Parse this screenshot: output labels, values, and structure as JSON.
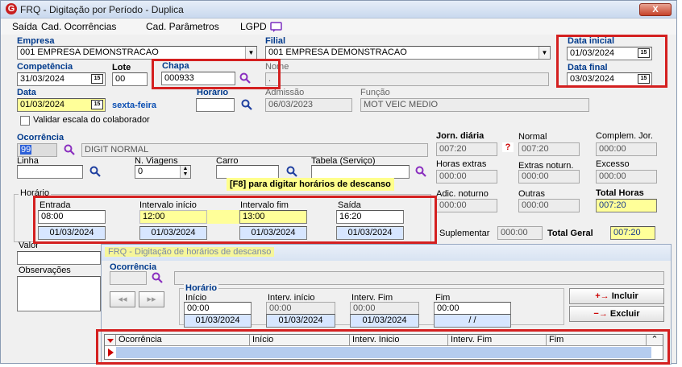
{
  "window": {
    "title": "FRQ - Digitação por Período - Duplica",
    "close_label": "X"
  },
  "menu": [
    {
      "label": "Saída"
    },
    {
      "label": "Cad. Ocorrências"
    },
    {
      "label": "Cad. Parâmetros"
    },
    {
      "label": "LGPD"
    }
  ],
  "empresa": {
    "label": "Empresa",
    "value": "001 EMPRESA DEMONSTRACAO"
  },
  "filial": {
    "label": "Filial",
    "value": "001 EMPRESA DEMONSTRACAO"
  },
  "data_inicial": {
    "label": "Data inicial",
    "value": "01/03/2024"
  },
  "data_final": {
    "label": "Data final",
    "value": "03/03/2024"
  },
  "competencia": {
    "label": "Competência",
    "value": "31/03/2024"
  },
  "lote": {
    "label": "Lote",
    "value": "00"
  },
  "chapa": {
    "label": "Chapa",
    "value": "000933"
  },
  "nome": {
    "label": "Nome",
    "value": "."
  },
  "data": {
    "label": "Data",
    "value": "01/03/2024",
    "weekday": "sexta-feira"
  },
  "horario": {
    "label": "Horário",
    "value": ""
  },
  "admissao": {
    "label": "Admissão",
    "value": "06/03/2023"
  },
  "funcao": {
    "label": "Função",
    "value": "MOT VEIC MEDIO"
  },
  "validar": {
    "label": "Validar escala do colaborador"
  },
  "ocorrencia": {
    "label": "Ocorrência",
    "code": "99",
    "desc": "DIGIT NORMAL"
  },
  "linha": {
    "label": "Linha",
    "value": ""
  },
  "viagens": {
    "label": "N. Viagens",
    "value": "0"
  },
  "carro": {
    "label": "Carro",
    "value": ""
  },
  "tabela": {
    "label": "Tabela (Serviço)",
    "value": ""
  },
  "hint_f8": "[F8] para digitar horários de descanso",
  "jornada": {
    "jorn_diaria": {
      "label": "Jorn. diária",
      "value": "007:20"
    },
    "normal": {
      "label": "Normal",
      "value": "007:20"
    },
    "complem": {
      "label": "Complem. Jor.",
      "value": "000:00"
    },
    "horas_extras": {
      "label": "Horas extras",
      "value": "000:00"
    },
    "extras_notu": {
      "label": "Extras noturn.",
      "value": "000:00"
    },
    "excesso": {
      "label": "Excesso",
      "value": "000:00"
    },
    "adic_noturno": {
      "label": "Adic. noturno",
      "value": "000:00"
    },
    "outras": {
      "label": "Outras",
      "value": "000:00"
    },
    "total_horas": {
      "label": "Total Horas",
      "value": "007:20"
    },
    "suplementar": {
      "label": "Suplementar",
      "value": "000:00"
    },
    "total_geral": {
      "label": "Total Geral",
      "value": "007:20"
    },
    "question": "?"
  },
  "horario_group": {
    "label": "Horário",
    "entrada": {
      "label": "Entrada",
      "time": "08:00",
      "date": "01/03/2024"
    },
    "int_inicio": {
      "label": "Intervalo início",
      "time": "12:00",
      "date": "01/03/2024"
    },
    "int_fim": {
      "label": "Intervalo fim",
      "time": "13:00",
      "date": "01/03/2024"
    },
    "saida": {
      "label": "Saída",
      "time": "16:20",
      "date": "01/03/2024"
    }
  },
  "valor": {
    "label": "Valor"
  },
  "observacoes": {
    "label": "Observações"
  },
  "sub": {
    "title": "FRQ - Digitação de horários de descanso",
    "ocorrencia_label": "Ocorrência",
    "horario_label": "Horário",
    "inicio": {
      "label": "Início",
      "time": "00:00",
      "date": "01/03/2024"
    },
    "int_inicio": {
      "label": "Interv. início",
      "time": "00:00",
      "date": "01/03/2024"
    },
    "int_fim": {
      "label": "Interv. Fim",
      "time": "00:00",
      "date": "01/03/2024"
    },
    "fim": {
      "label": "Fim",
      "time": "00:00",
      "date": "/ /"
    },
    "incluir": "Incluir",
    "excluir": "Excluir",
    "grid_columns": [
      "Ocorrência",
      "Início",
      "Interv. Inicio",
      "Interv. Fim",
      "Fim"
    ]
  }
}
